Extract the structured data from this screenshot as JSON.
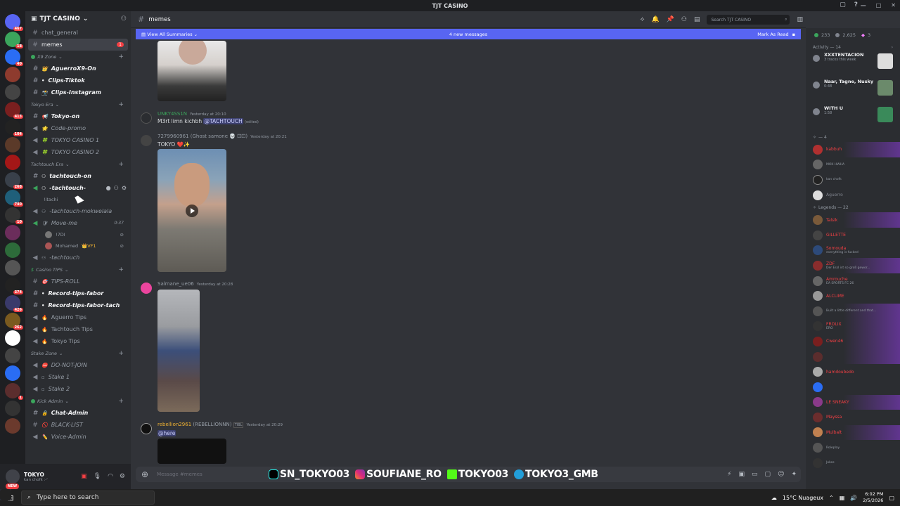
{
  "window": {
    "title": "TJT CASINO"
  },
  "server": {
    "name": "TJT CASINO",
    "rail_badges": [
      "467",
      "18",
      "40",
      "413",
      "104",
      "268",
      "740",
      "10",
      "374",
      "426",
      "262",
      "1"
    ]
  },
  "sidebar": {
    "top_channels": [
      {
        "label": "chat_general",
        "active": false
      },
      {
        "label": "memes",
        "active": true,
        "badge": "1"
      }
    ],
    "categories": [
      {
        "name": "X9 Zone",
        "channels": [
          {
            "label": "AguerroX9-On",
            "emoji": "👑"
          },
          {
            "label": "Clips-Tiktok",
            "emoji": "•"
          },
          {
            "label": "Clips-Instagram",
            "emoji": "📸"
          }
        ]
      },
      {
        "name": "Tokyo Era",
        "channels": [
          {
            "label": "Tokyo-on",
            "emoji": "📢"
          },
          {
            "label": "Code-promo",
            "emoji": "🌟"
          },
          {
            "label": "TOKYO CASINO 1",
            "emoji": "🍀"
          },
          {
            "label": "TOKYO CASINO 2",
            "emoji": "🍀"
          }
        ]
      },
      {
        "name": "Tachtouch Era",
        "channels": [
          {
            "label": "tachtouch-on"
          },
          {
            "label": "-tachtouch-",
            "sub": "!itachi"
          },
          {
            "label": "-tachtouch-mokwelala"
          },
          {
            "label": "Move-me",
            "time": "0:37"
          },
          {
            "label": "-tachtouch"
          }
        ],
        "voice_users": [
          {
            "name": "!7DI"
          },
          {
            "name": "Mohamed",
            "tag": "👑VF1"
          }
        ]
      },
      {
        "name": "Casino TIPS",
        "channels": [
          {
            "label": "TIPS-ROLL",
            "emoji": "🎯"
          },
          {
            "label": "Record-tips-fabor"
          },
          {
            "label": "Record-tips-fabor-tach"
          },
          {
            "label": "Aguerro Tips",
            "emoji": "🔥"
          },
          {
            "label": "Tachtouch Tips",
            "emoji": "🔥"
          },
          {
            "label": "Tokyo Tips",
            "emoji": "🔥"
          }
        ]
      },
      {
        "name": "Stake Zone",
        "channels": [
          {
            "label": "DO-NOT-JOIN",
            "emoji": "⛔"
          },
          {
            "label": "Stake 1"
          },
          {
            "label": "Stake 2"
          }
        ]
      },
      {
        "name": "Kick Admin",
        "channels": [
          {
            "label": "Chat-Admin",
            "emoji": "🔒"
          },
          {
            "label": "BLACK-LIST",
            "emoji": "🚫"
          },
          {
            "label": "Voice-Admin",
            "emoji": "✏️"
          }
        ]
      }
    ]
  },
  "user_panel": {
    "name": "TOKYO",
    "status": "kan chofk :-'",
    "new_badge": "NEW"
  },
  "channel": {
    "name": "memes",
    "search_placeholder": "Search TJT CASINO"
  },
  "summary_bar": {
    "left": "View All Summaries",
    "center": "4 new messages",
    "right": "Mark As Read"
  },
  "messages": [
    {
      "user": "UNKY4SS1N",
      "timestamp": "Yesterday at 20:10",
      "text": "M3rt limn kichbh",
      "mention": "@TACHTOUCH",
      "edited": "(edited)"
    },
    {
      "user": "7279960961",
      "display": "(Ghost samone 💀 ⚀⚀)",
      "timestamp": "Yesterday at 20:21",
      "text": "TOKYO ❤️✨"
    },
    {
      "user": "Salmane_ue06",
      "timestamp": "Yesterday at 20:28"
    },
    {
      "user": "rebellion2961",
      "display": "(REBELLIONNN)",
      "tag": "TIBL",
      "timestamp": "Yesterday at 20:29",
      "text": "@here"
    }
  ],
  "composer": {
    "placeholder": "Message #memes"
  },
  "socials": [
    {
      "icon": "tiktok-icon",
      "handle": "SN_TOKYO03"
    },
    {
      "icon": "instagram-icon",
      "handle": "SOUFIANE_RO"
    },
    {
      "icon": "kick-icon",
      "handle": "TOKYO03"
    },
    {
      "icon": "telegram-icon",
      "handle": "TOKYO3_GMB"
    }
  ],
  "members": {
    "stats": {
      "online": "233",
      "total": "2,625",
      "boost": "3"
    },
    "activity_header": "Activity — 14",
    "activities": [
      {
        "title": "XXXTENTACION",
        "sub": "3 tracks this week"
      },
      {
        "title": "Naar, Tagne, Nusky",
        "sub": "0:48"
      },
      {
        "title": "WITH U",
        "sub": "1:58"
      }
    ],
    "group1_header": "— 4",
    "group1": [
      {
        "name": "kabbuh",
        "line": ""
      },
      {
        "name": "",
        "line": "MOK HWHA"
      },
      {
        "name": "",
        "line": "kan chofk"
      },
      {
        "name": "Aguerro",
        "line": ""
      }
    ],
    "legends_header": "Legends — 22",
    "legends": [
      {
        "name": "Talsik",
        "line": ""
      },
      {
        "name": "GILLETTE",
        "line": ""
      },
      {
        "name": "Somouda",
        "line": "everything is fucked"
      },
      {
        "name": "ZDF",
        "line": "Der Essl ist so groß gewor..."
      },
      {
        "name": "Amrouche",
        "line": "EA SPORTS FC 26"
      },
      {
        "name": "ALCLIME",
        "line": ""
      },
      {
        "name": "",
        "line": "Built a little different and that..."
      },
      {
        "name": "FROLIX",
        "line": "ERO"
      },
      {
        "name": "Cwen46",
        "line": ""
      },
      {
        "name": "",
        "line": ""
      },
      {
        "name": "hamdoubedo",
        "line": ""
      },
      {
        "name": "",
        "line": ""
      },
      {
        "name": "LE SNEAKY",
        "line": ""
      },
      {
        "name": "Mayssa",
        "line": ""
      },
      {
        "name": "Mulbalt",
        "line": ""
      },
      {
        "name": "",
        "line": "Roleplay"
      },
      {
        "name": "",
        "line": "Jokes"
      }
    ]
  },
  "taskbar": {
    "search_placeholder": "Type here to search",
    "weather": "15°C Nuageux",
    "time": "6:02 PM",
    "date": "2/5/2026"
  }
}
